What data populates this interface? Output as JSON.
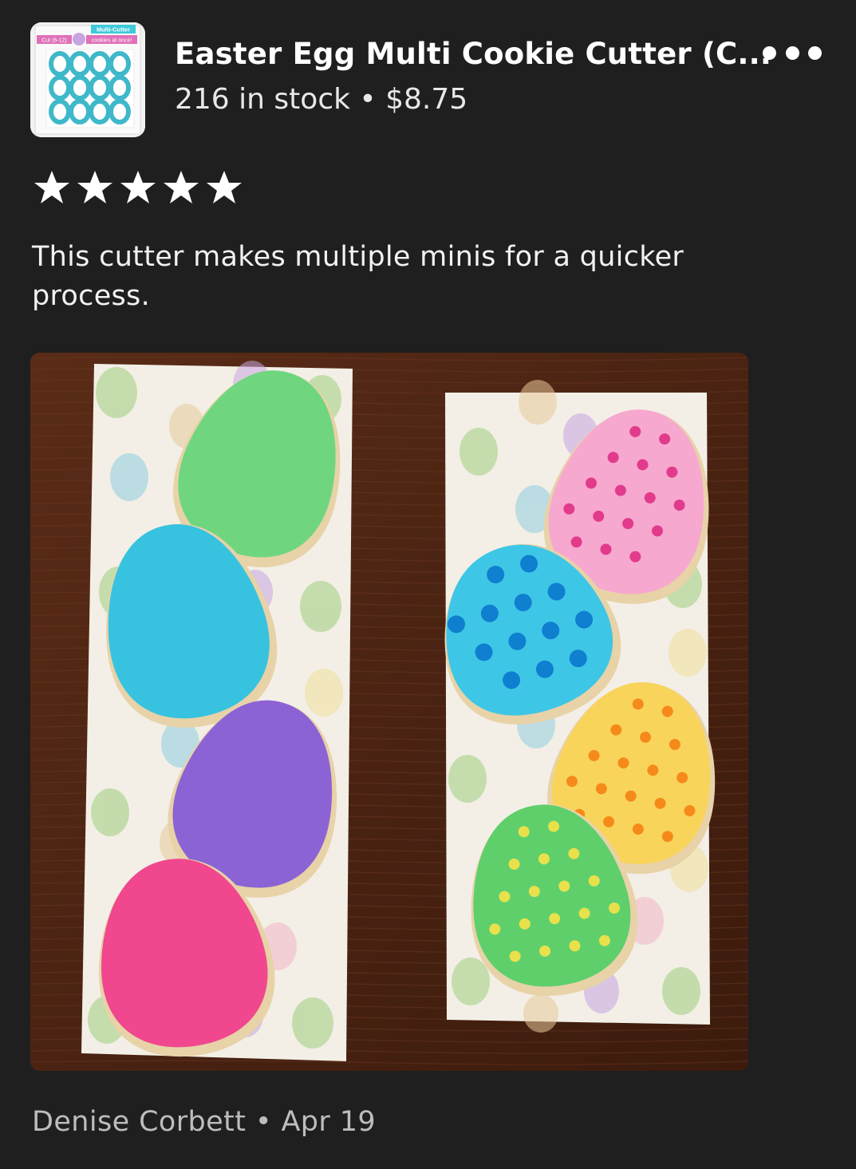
{
  "product": {
    "title": "Easter Egg Multi Cookie Cutter (C...",
    "stock": "216 in stock",
    "separator": "•",
    "price": "$8.75",
    "thumbnail": {
      "banner_top": "Multi-Cutter",
      "banner_left": "Cut (6-12)",
      "banner_right": "cookies at once!",
      "accent_color": "#3fb8c9"
    }
  },
  "rating": {
    "stars": 5,
    "max": 5,
    "star_color": "#ffffff"
  },
  "review": {
    "text": "This cutter makes multiple minis for a quicker process.",
    "author": "Denise Corbett",
    "separator": "•",
    "date": "Apr 19"
  },
  "menu": {
    "icon": "more-horizontal-icon"
  },
  "photo": {
    "subject": "decorated egg cookies",
    "left_board_colors": [
      "#6fd67f",
      "#37c3e0",
      "#8c63d4",
      "#f0478e"
    ],
    "right_board_colors": [
      "#f7a8cf",
      "#3ec6e6",
      "#f9d45a",
      "#5fcf6c"
    ],
    "right_board_dot_colors": [
      "#e23b8c",
      "#0f7fd0",
      "#f58a1a",
      "#e8e14b"
    ]
  },
  "theme": {
    "background": "#1f1f1f",
    "text_primary": "#ffffff",
    "text_secondary": "#bdbdbd"
  }
}
